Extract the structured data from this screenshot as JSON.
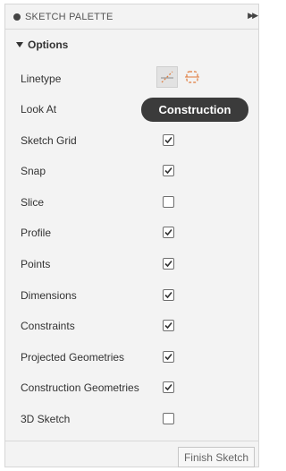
{
  "palette": {
    "title": "SKETCH PALETTE",
    "section": "Options"
  },
  "linetype": {
    "label": "Linetype",
    "buttons": [
      {
        "name": "construction-linetype-icon",
        "active": true
      },
      {
        "name": "centerline-linetype-icon",
        "active": false
      }
    ]
  },
  "tooltip": "Construction",
  "options": [
    {
      "label": "Look At",
      "checkbox": false,
      "checked": null
    },
    {
      "label": "Sketch Grid",
      "checkbox": true,
      "checked": true
    },
    {
      "label": "Snap",
      "checkbox": true,
      "checked": true
    },
    {
      "label": "Slice",
      "checkbox": true,
      "checked": false
    },
    {
      "label": "Profile",
      "checkbox": true,
      "checked": true
    },
    {
      "label": "Points",
      "checkbox": true,
      "checked": true
    },
    {
      "label": "Dimensions",
      "checkbox": true,
      "checked": true
    },
    {
      "label": "Constraints",
      "checkbox": true,
      "checked": true
    },
    {
      "label": "Projected Geometries",
      "checkbox": true,
      "checked": true
    },
    {
      "label": "Construction Geometries",
      "checkbox": true,
      "checked": true
    },
    {
      "label": "3D Sketch",
      "checkbox": true,
      "checked": false
    }
  ],
  "footer": {
    "finish_label": "Finish Sketch"
  }
}
